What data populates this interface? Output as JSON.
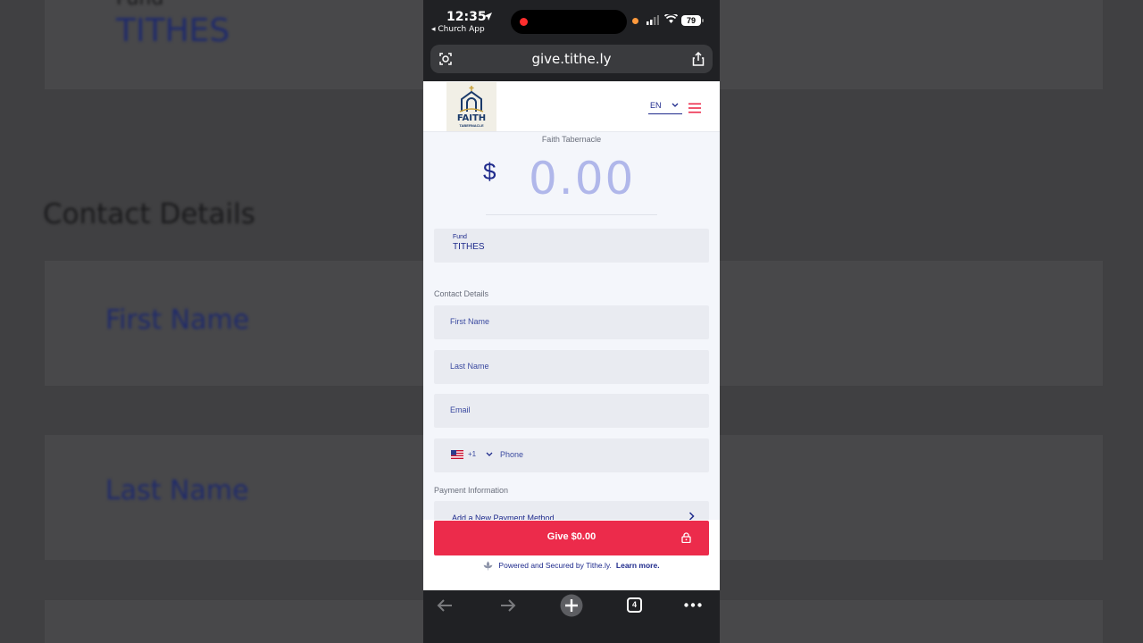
{
  "background": {
    "fund_label": "Fund",
    "fund_value": "TITHES",
    "contact_heading": "Contact Details",
    "first_name": "First Name",
    "last_name": "Last Name"
  },
  "status_bar": {
    "time": "12:35",
    "back_app": "◂ Church App",
    "battery": "79"
  },
  "browser": {
    "url": "give.tithe.ly",
    "tab_count": "4"
  },
  "header": {
    "logo_title": "FAITH",
    "logo_subtitle": "TABERNACLE",
    "language": "EN"
  },
  "form": {
    "church_name": "Faith Tabernacle",
    "currency_symbol": "$",
    "amount": "0.00",
    "fund_label": "Fund",
    "fund_value": "TITHES",
    "contact_heading": "Contact Details",
    "first_name_placeholder": "First Name",
    "last_name_placeholder": "Last Name",
    "email_placeholder": "Email",
    "country_code": "+1",
    "phone_placeholder": "Phone",
    "payment_heading": "Payment Information",
    "add_payment_label": "Add a New Payment Method"
  },
  "footer": {
    "give_label": "Give $0.00",
    "powered_text": "Powered and Secured by Tithe.ly.",
    "learn_more": "Learn more."
  },
  "colors": {
    "accent_red": "#ec2b4b",
    "brand_blue": "#1e2a8c",
    "amount_placeholder": "#b0b7ea"
  }
}
